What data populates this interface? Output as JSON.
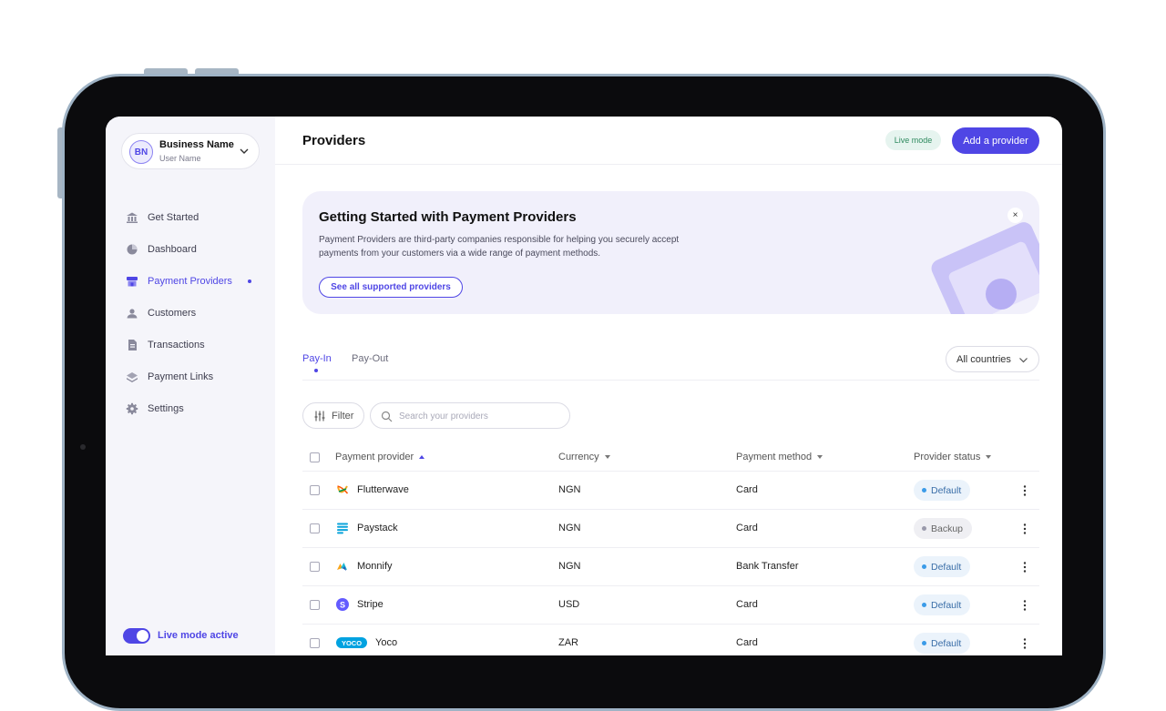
{
  "sidebar": {
    "business": {
      "initials": "BN",
      "name": "Business Name",
      "user": "User Name"
    },
    "items": [
      {
        "label": "Get Started",
        "icon": "bank-icon",
        "active": false
      },
      {
        "label": "Dashboard",
        "icon": "pie-chart-icon",
        "active": false
      },
      {
        "label": "Payment Providers",
        "icon": "storefront-icon",
        "active": true
      },
      {
        "label": "Customers",
        "icon": "customers-icon",
        "active": false
      },
      {
        "label": "Transactions",
        "icon": "document-icon",
        "active": false
      },
      {
        "label": "Payment Links",
        "icon": "layers-icon",
        "active": false
      },
      {
        "label": "Settings",
        "icon": "gear-icon",
        "active": false
      }
    ],
    "live_mode_label": "Live mode active"
  },
  "header": {
    "title": "Providers",
    "live_badge": "Live mode",
    "add_button": "Add a provider"
  },
  "banner": {
    "title": "Getting Started with Payment Providers",
    "description": "Payment Providers are third-party companies responsible for helping you securely accept payments from your customers via a wide range of payment methods.",
    "button": "See all supported providers",
    "close": "×"
  },
  "tabs": [
    {
      "label": "Pay-In",
      "active": true
    },
    {
      "label": "Pay-Out",
      "active": false
    }
  ],
  "country_select": "All countries",
  "filter_label": "Filter",
  "search": {
    "placeholder": "Search your providers",
    "value": ""
  },
  "table": {
    "columns": [
      "Payment provider",
      "Currency",
      "Payment method",
      "Provider status"
    ],
    "rows": [
      {
        "provider": "Flutterwave",
        "logo": "flutterwave-logo-icon",
        "currency": "NGN",
        "method": "Card",
        "status": "Default"
      },
      {
        "provider": "Paystack",
        "logo": "paystack-logo-icon",
        "currency": "NGN",
        "method": "Card",
        "status": "Backup"
      },
      {
        "provider": "Monnify",
        "logo": "monnify-logo-icon",
        "currency": "NGN",
        "method": "Bank Transfer",
        "status": "Default"
      },
      {
        "provider": "Stripe",
        "logo": "stripe-logo-icon",
        "currency": "USD",
        "method": "Card",
        "status": "Default"
      },
      {
        "provider": "Yoco",
        "logo": "yoco-logo-icon",
        "currency": "ZAR",
        "method": "Card",
        "status": "Default"
      }
    ]
  },
  "colors": {
    "accent": "#4f46e5",
    "live_badge_bg": "#e6f4ef",
    "default_dot": "#3b9be8",
    "backup_dot": "#9a9aab"
  }
}
